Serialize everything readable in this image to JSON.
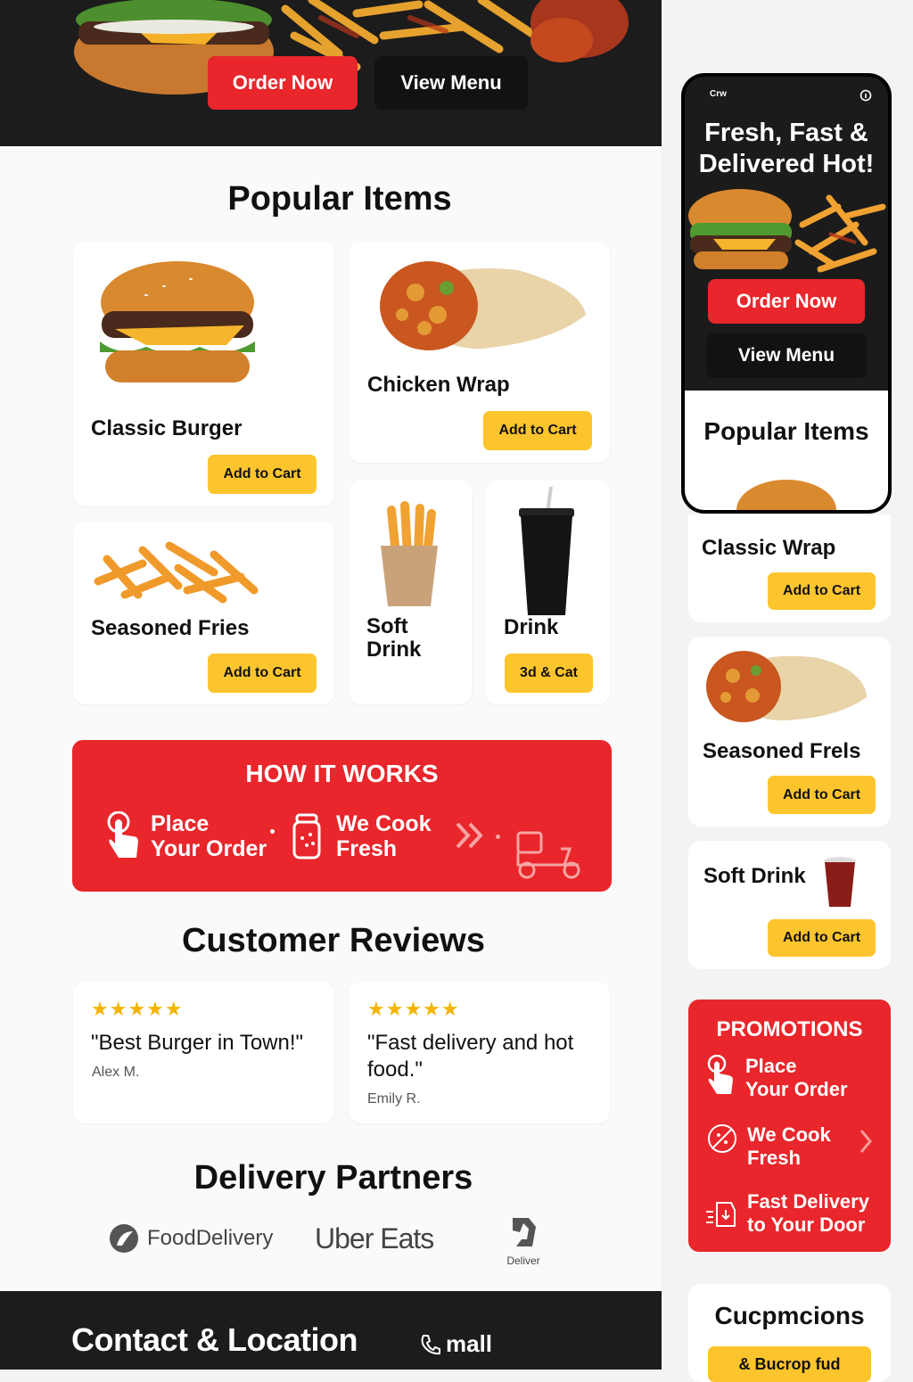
{
  "hero": {
    "order_now": "Order Now",
    "view_menu": "View Menu"
  },
  "popular": {
    "title": "Popular Items",
    "items": [
      {
        "name": "Classic Burger",
        "button": "Add to Cart"
      },
      {
        "name": "Chicken Wrap",
        "button": "Add to Cart"
      },
      {
        "name": "Seasoned Fries",
        "button": "Add to Cart"
      },
      {
        "name": "Soft\nDrink",
        "name_line1": "Soft",
        "name_line2": "Drink"
      },
      {
        "name": "Drink",
        "button": "3d & Cat"
      }
    ]
  },
  "how_it_works": {
    "title": "HOW IT WORKS",
    "steps": [
      {
        "line1": "Place",
        "line2": "Your Order",
        "icon": "hand-pointer-icon"
      },
      {
        "line1": "We Cook",
        "line2": "Fresh",
        "icon": "cooking-pot-icon"
      },
      {
        "icon": "delivery-scooter-icon"
      }
    ]
  },
  "reviews": {
    "title": "Customer Reviews",
    "items": [
      {
        "stars": "★★★★★",
        "text": "\"Best Burger in Town!\"",
        "author": "Alex M."
      },
      {
        "stars": "★★★★★",
        "text_line1": "\"Fast delivery and hot",
        "text_line2": "food.\"",
        "author": "Emily R."
      }
    ]
  },
  "partners": {
    "title": "Delivery Partners",
    "items": [
      "FoodDelivery",
      "Uber Eats",
      "Deliver"
    ]
  },
  "footer": {
    "title": "Contact & Location",
    "link": "mall"
  },
  "phone": {
    "status_left": "Crw",
    "headline_line1": "Fresh, Fast &",
    "headline_line2": "Delivered Hot!",
    "order_now": "Order Now",
    "view_menu": "View Menu",
    "popular_title": "Popular Items"
  },
  "sidebar": {
    "cards": [
      {
        "name": "Classic Wrap",
        "button": "Add to Cart"
      },
      {
        "name": "Seasoned Frels",
        "button": "Add to Cart"
      },
      {
        "name": "Soft Drink",
        "button": "Add to Cart"
      }
    ],
    "promotions": {
      "title": "PROMOTIONS",
      "items": [
        {
          "line1": "Place",
          "line2": "Your Order",
          "icon": "hand-pointer-icon"
        },
        {
          "line1": "We Cook",
          "line2": "Fresh",
          "icon": "pizza-icon"
        },
        {
          "line1": "Fast Delivery",
          "line2": "to Your Door",
          "icon": "fast-delivery-icon"
        }
      ]
    },
    "coupons": {
      "title": "Cucpmcions",
      "button": "& Bucrop fud"
    }
  },
  "colors": {
    "accent_red": "#e8262b",
    "accent_yellow": "#fdc52d",
    "dark": "#1c1c1c"
  }
}
